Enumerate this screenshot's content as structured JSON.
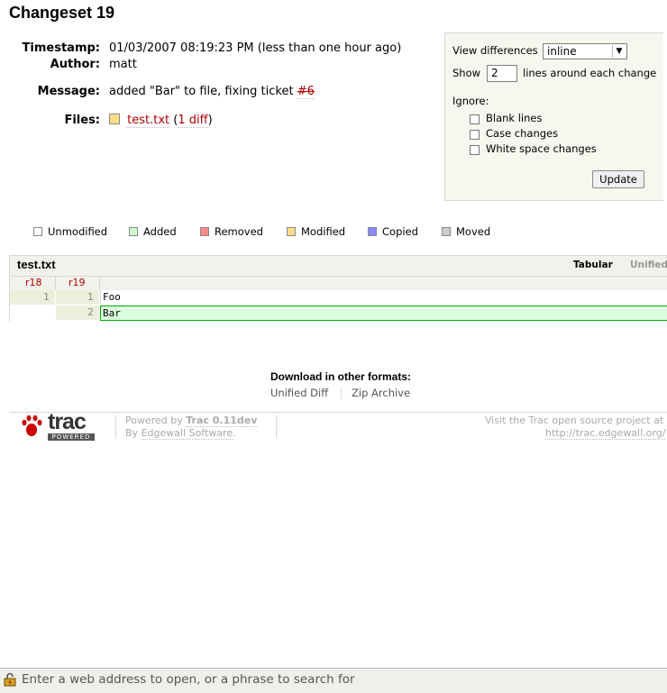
{
  "page_title": "Changeset 19",
  "meta": {
    "timestamp_label": "Timestamp:",
    "timestamp": "01/03/2007 08:19:23 PM (less than one hour ago)",
    "author_label": "Author:",
    "author": "matt",
    "message_label": "Message:",
    "message_text": "added \"Bar\" to file, fixing ticket",
    "ticket_link": "#6",
    "files_label": "Files:",
    "file_name": "test.txt",
    "file_diff_open": "(",
    "file_diff_link": "1 diff",
    "file_diff_close": ")"
  },
  "options": {
    "view_label": "View differences",
    "view_value": "inline",
    "show_label": "Show",
    "context_lines": "2",
    "context_suffix": "lines around each change",
    "ignore_label": "Ignore:",
    "ignore_items": [
      "Blank lines",
      "Case changes",
      "White space changes"
    ],
    "update_label": "Update"
  },
  "legend": {
    "items": [
      {
        "label": "Unmodified",
        "color": "#ffffff"
      },
      {
        "label": "Added",
        "color": "#cfc"
      },
      {
        "label": "Removed",
        "color": "#f88"
      },
      {
        "label": "Modified",
        "color": "#fd8"
      },
      {
        "label": "Copied",
        "color": "#88f"
      },
      {
        "label": "Moved",
        "color": "#ccc"
      }
    ]
  },
  "diff": {
    "file_name": "test.txt",
    "view_tabular": "Tabular",
    "view_unified": "Unified",
    "old_rev": "r18",
    "new_rev": "r19",
    "lines": [
      {
        "old": "1",
        "new": "1",
        "text": "Foo",
        "type": "unmod"
      },
      {
        "old": "",
        "new": "2",
        "text": "Bar",
        "type": "add"
      }
    ]
  },
  "download": {
    "title": "Download in other formats:",
    "unified_diff": "Unified Diff",
    "zip_archive": "Zip Archive"
  },
  "footer": {
    "logo_text": "trac",
    "logo_sub": "POWERED",
    "powered_by": "Powered by",
    "trac_version": "Trac 0.11dev",
    "by": "By",
    "edgewall": "Edgewall Software",
    "period": ".",
    "visit": "Visit the Trac open source project at",
    "url": "http://trac.edgewall.org/"
  },
  "statusbar": {
    "address_placeholder": "Enter a web address to open, or a phrase to search for"
  },
  "colors": {
    "link": "#b00000",
    "added_bg": "#ddffdd",
    "added_border": "#00aa00",
    "header_bg": "#f2f2ec"
  }
}
